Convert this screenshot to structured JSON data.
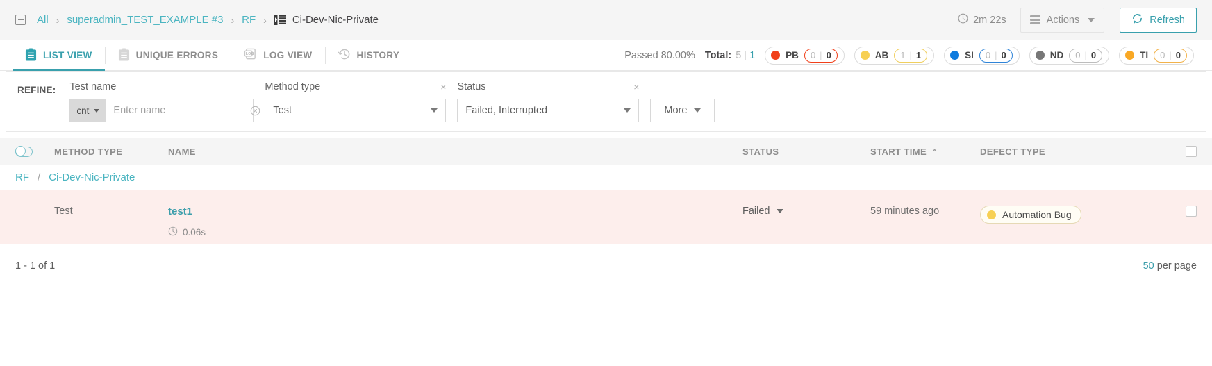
{
  "breadcrumb": {
    "collapse_icon": "collapse-box-icon",
    "items": [
      {
        "label": "All",
        "type": "link"
      },
      {
        "label": "superadmin_TEST_EXAMPLE #3",
        "type": "link"
      },
      {
        "label": "RF",
        "type": "link"
      },
      {
        "label": "Ci-Dev-Nic-Private",
        "type": "current",
        "icon": "test-item-icon"
      }
    ],
    "separator": "›"
  },
  "header": {
    "duration_icon": "clock-icon",
    "duration": "2m 22s",
    "actions_label": "Actions",
    "actions_icon": "hamburger-icon",
    "refresh_label": "Refresh",
    "refresh_icon": "refresh-icon"
  },
  "tabs": [
    {
      "label": "LIST VIEW",
      "icon": "clipboard-icon",
      "active": true
    },
    {
      "label": "UNIQUE ERRORS",
      "icon": "clipboard-outline-icon",
      "active": false
    },
    {
      "label": "LOG VIEW",
      "icon": "log-icon",
      "active": false
    },
    {
      "label": "HISTORY",
      "icon": "history-clock-icon",
      "active": false
    }
  ],
  "stats": {
    "passed_label": "Passed 80.00%",
    "total_label": "Total:",
    "total_primary": "5",
    "total_divider": "|",
    "total_secondary": "1",
    "badges": [
      {
        "label": "PB",
        "dot_color": "#f1401a",
        "border_color": "#f1401a",
        "count_a": "0",
        "count_b": "0"
      },
      {
        "label": "AB",
        "dot_color": "#f7d054",
        "border_color": "#f0cf5e",
        "count_a": "1",
        "count_b": "1"
      },
      {
        "label": "SI",
        "dot_color": "#0f7bde",
        "border_color": "#2f84d8",
        "count_a": "0",
        "count_b": "0"
      },
      {
        "label": "ND",
        "dot_color": "#777777",
        "border_color": "#bdbdbd",
        "count_a": "0",
        "count_b": "0"
      },
      {
        "label": "TI",
        "dot_color": "#f9a825",
        "border_color": "#f2b24a",
        "count_a": "0",
        "count_b": "0"
      }
    ]
  },
  "refine": {
    "label": "REFINE:",
    "test_name": {
      "title": "Test name",
      "condition": "cnt",
      "placeholder": "Enter name",
      "value": ""
    },
    "method_type": {
      "title": "Method type",
      "value": "Test",
      "clear": "×"
    },
    "status": {
      "title": "Status",
      "value": "Failed, Interrupted",
      "clear": "×"
    },
    "more_label": "More"
  },
  "table": {
    "columns": {
      "method_type": "METHOD TYPE",
      "name": "NAME",
      "status": "STATUS",
      "start_time": "START TIME",
      "start_time_sort": "⌃",
      "defect_type": "DEFECT TYPE"
    },
    "group_row": {
      "parent": "RF",
      "separator": "/",
      "child": "Ci-Dev-Nic-Private"
    },
    "rows": [
      {
        "method_type": "Test",
        "name": "test1",
        "duration_icon": "clock-icon",
        "duration": "0.06s",
        "status": "Failed",
        "start_time": "59 minutes ago",
        "defect_type": "Automation Bug",
        "defect_dot_color": "#f7d054"
      }
    ]
  },
  "footer": {
    "range": "1 - 1 of 1",
    "per_page_number": "50",
    "per_page_label": "per page"
  }
}
